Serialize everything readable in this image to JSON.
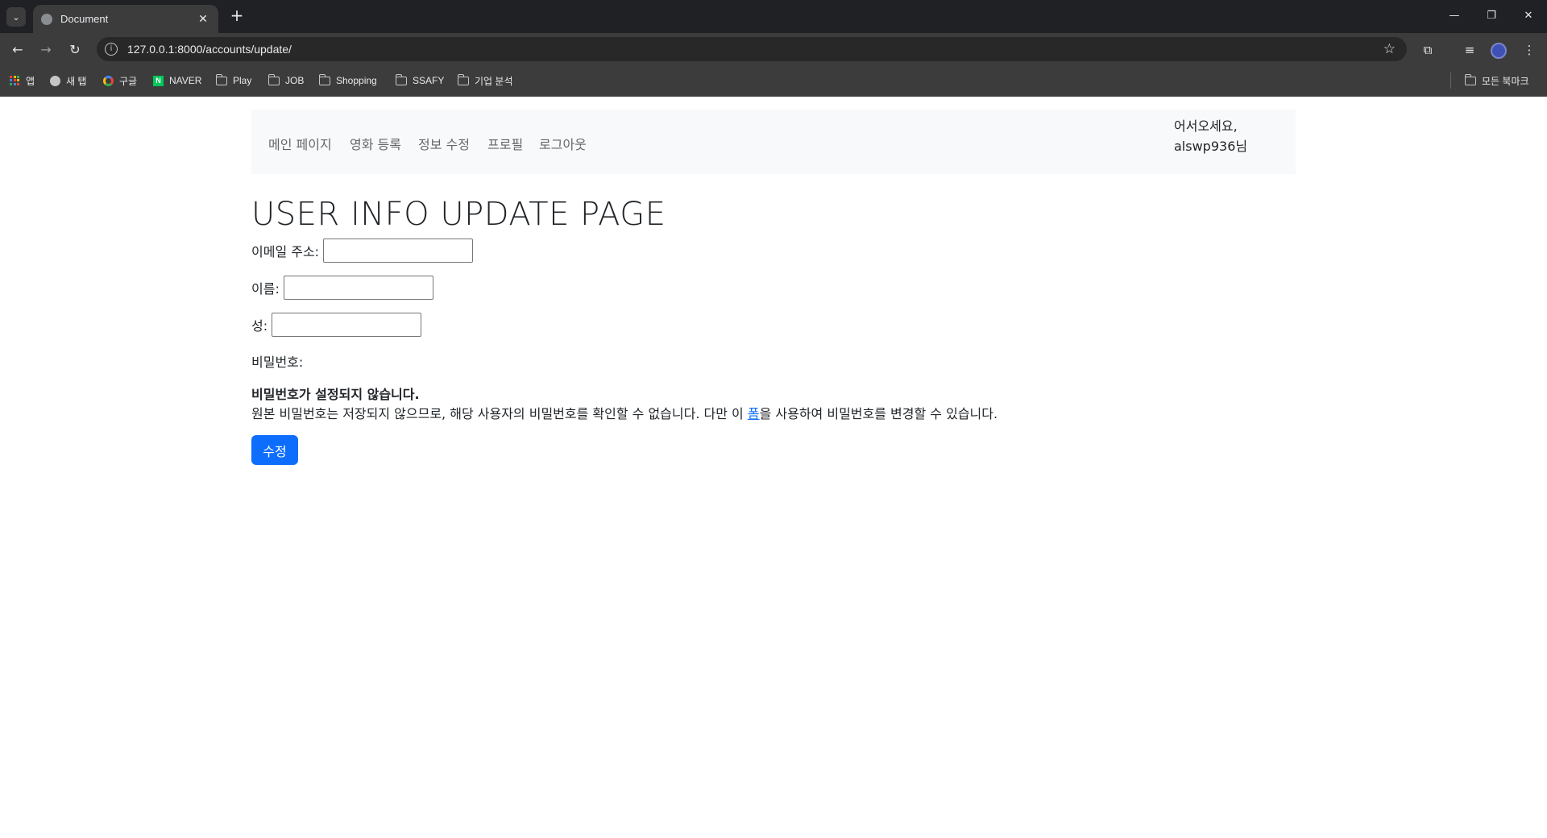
{
  "browser": {
    "tab_title": "Document",
    "url": "127.0.0.1:8000/accounts/update/",
    "bookmarks": [
      "앱",
      "새 탭",
      "구글",
      "NAVER",
      "Play",
      "JOB",
      "Shopping",
      "SSAFY",
      "기업 분석"
    ],
    "all_bookmarks": "모든 북마크"
  },
  "navbar": {
    "links": [
      "메인 페이지",
      "영화 등록",
      "정보 수정",
      "프로필",
      "로그아웃"
    ],
    "greeting_line1": "어서오세요,",
    "greeting_line2": "alswp936님"
  },
  "main": {
    "title": "USER INFO UPDATE PAGE",
    "email_label": "이메일 주소:",
    "email_value": "",
    "first_name_label": "이름:",
    "first_name_value": "",
    "last_name_label": "성:",
    "last_name_value": "",
    "password_label": "비밀번호:",
    "password_help_strong": "비밀번호가 설정되지 않습니다.",
    "password_help_before": "원본 비밀번호는 저장되지 않으므로, 해당 사용자의 비밀번호를 확인할 수 없습니다. 다만 이 ",
    "password_help_link": "폼",
    "password_help_after": "을 사용하여 비밀번호를 변경할 수 있습니다.",
    "submit_label": "수정"
  },
  "colors": {
    "primary": "#0d6efd",
    "navbar_bg": "#f8f9fa",
    "chrome_dark": "#202124",
    "chrome_toolbar": "#3c3c3c"
  }
}
